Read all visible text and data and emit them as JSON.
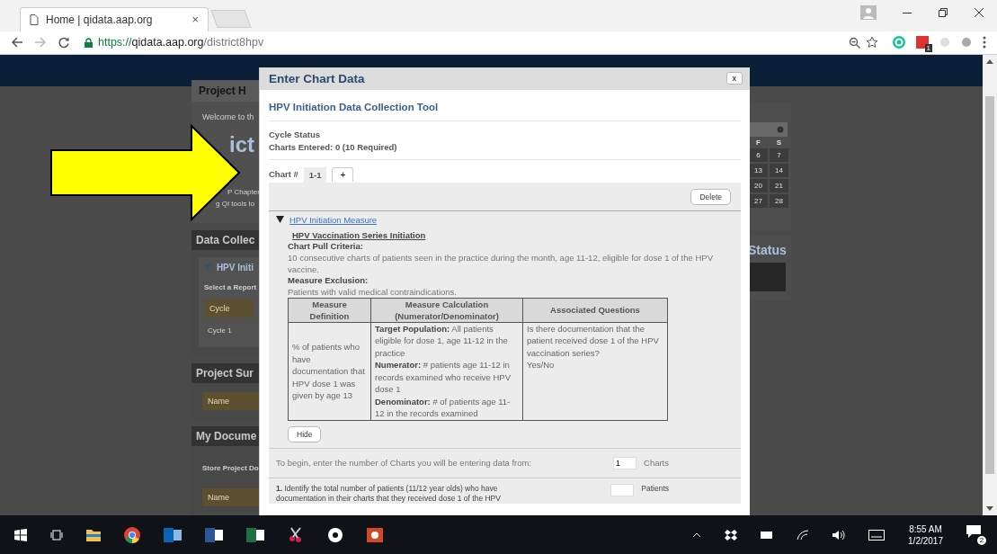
{
  "browser": {
    "tab_title": "Home | qidata.aap.org",
    "tab_close": "×",
    "url": {
      "scheme": "https://",
      "host": "qidata.aap.org",
      "path": "/district8hpv"
    },
    "extension_badge": "1"
  },
  "background_page": {
    "header_tab": "Project H",
    "welcome": "Welcome to th",
    "title_fragment": "ict",
    "chapter_fragment": "P Chapter",
    "tools_fragment": "g QI tools to",
    "data_collection": {
      "heading": "Data Collec",
      "measure": "HPV Initi",
      "expanded": true,
      "select_label": "Select a Report",
      "column": "Cycle",
      "row": "Cycle 1"
    },
    "project_summary": {
      "heading": "Project Sur",
      "column": "Name"
    },
    "my_documents": {
      "heading": "My Docume",
      "label": "Store Project Do",
      "column": "Name"
    },
    "calendar": {
      "weekdays": [
        "F",
        "S"
      ],
      "weeks": [
        [
          "6",
          "7"
        ],
        [
          "13",
          "14"
        ],
        [
          "20",
          "21"
        ],
        [
          "27",
          "28"
        ]
      ]
    },
    "status_heading": "Status"
  },
  "modal": {
    "title": "Enter Chart Data",
    "close": "x",
    "tool_title": "HPV Initiation Data Collection Tool",
    "cycle_status_label": "Cycle Status",
    "charts_entered": "Charts Entered: 0 (10 Required)",
    "chart_label": "Chart #",
    "chart_tabs": [
      {
        "label": "1-1",
        "selected": true
      }
    ],
    "add_chart": "+",
    "delete": "Delete",
    "measure": {
      "label": "HPV Initiation Measure",
      "expanded": true,
      "heading": "HPV Vaccination Series Initiation",
      "criteria_label": "Chart Pull Criteria:",
      "criteria": "10 consecutive charts of patients seen in the practice during the month, age 11-12, eligible for dose 1 of the HPV vaccine.",
      "exclusion_label": "Measure Exclusion:",
      "exclusion": "Patients with valid medical contraindications.",
      "table": {
        "columns": [
          "Measure Definition",
          "Measure Calculation (Numerator/Denominator)",
          "Associated Questions"
        ],
        "rows": [
          {
            "definition": "% of patients who have documentation that HPV dose 1 was given by age 13",
            "calculation": [
              "**Target Population:** All patients eligible  for dose 1, age 11-12  in the practice",
              "**Numerator:** # patients age 11-12 in records examined who receive HPV dose 1",
              "**Denominator:** # of patients age 11-12 in the records examined"
            ],
            "questions": [
              "Is there documentation that the patient received dose 1 of the HPV vaccination series?",
              "Yes/No"
            ]
          }
        ]
      },
      "hide": "Hide"
    },
    "charts_prompt": "To begin, enter the number of Charts you will be entering data from:",
    "charts_count": "1",
    "charts_unit": "Charts",
    "question": {
      "text": "**1.** Identify the total number of patients (11/12 year olds) who have documentation in their charts that they received dose 1 of the HPV",
      "unit": "Patients"
    }
  },
  "taskbar": {
    "time": "8:55 AM",
    "date": "1/2/2017",
    "notification_count": "2"
  }
}
